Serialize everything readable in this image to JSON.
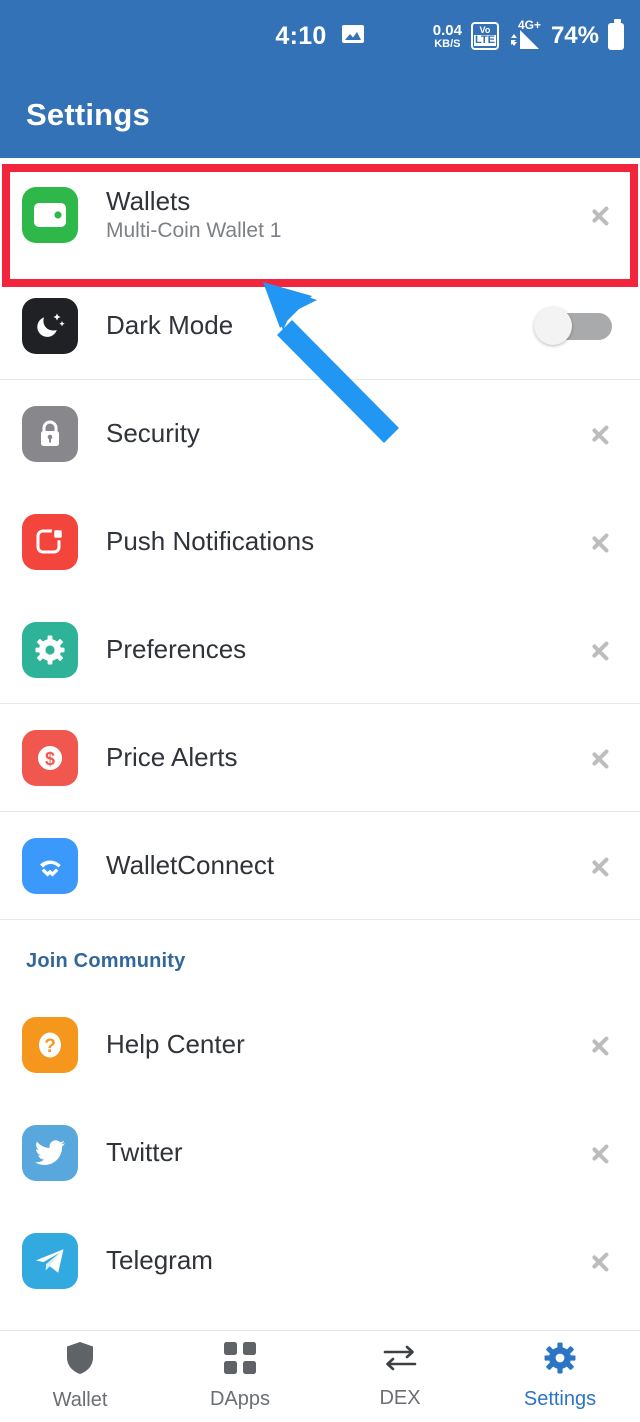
{
  "status_bar": {
    "time": "4:10",
    "screenshot_icon": "image-icon",
    "data_rate_value": "0.04",
    "data_rate_unit": "KB/S",
    "volte_top": "Vo",
    "volte_bottom": "LTE",
    "network_type": "4G+",
    "battery_percent": "74%"
  },
  "app_bar": {
    "title": "Settings"
  },
  "settings_items": [
    {
      "label": "Wallets",
      "sublabel": "Multi-Coin Wallet 1",
      "icon": "wallet-icon",
      "icon_color": "#2FB84A",
      "accessory": "chevron"
    },
    {
      "label": "Dark Mode",
      "sublabel": "",
      "icon": "moon-stars-icon",
      "icon_color": "#1F2124",
      "accessory": "toggle",
      "toggle_on": false
    },
    {
      "label": "Security",
      "sublabel": "",
      "icon": "lock-icon",
      "icon_color": "#87878C",
      "accessory": "chevron"
    },
    {
      "label": "Push Notifications",
      "sublabel": "",
      "icon": "notification-badge-icon",
      "icon_color": "#F4453C",
      "accessory": "chevron"
    },
    {
      "label": "Preferences",
      "sublabel": "",
      "icon": "gear-icon",
      "icon_color": "#2EB398",
      "accessory": "chevron"
    },
    {
      "label": "Price Alerts",
      "sublabel": "",
      "icon": "dollar-circle-icon",
      "icon_color": "#F0584F",
      "accessory": "chevron"
    },
    {
      "label": "WalletConnect",
      "sublabel": "",
      "icon": "walletconnect-icon",
      "icon_color": "#3B99FC",
      "accessory": "chevron"
    }
  ],
  "community_section": {
    "header": "Join Community",
    "header_color": "#336699",
    "items": [
      {
        "label": "Help Center",
        "icon": "question-mark-icon",
        "icon_color": "#F6971D",
        "accessory": "chevron"
      },
      {
        "label": "Twitter",
        "icon": "twitter-bird-icon",
        "icon_color": "#58A8DD",
        "accessory": "chevron"
      },
      {
        "label": "Telegram",
        "icon": "telegram-plane-icon",
        "icon_color": "#32AADF",
        "accessory": "chevron"
      }
    ]
  },
  "bottom_nav": {
    "active_index": 3,
    "active_color": "#2C74C4",
    "inactive_color": "#6B6E72",
    "items": [
      {
        "label": "Wallet",
        "icon": "shield-icon"
      },
      {
        "label": "DApps",
        "icon": "grid-squares-icon"
      },
      {
        "label": "DEX",
        "icon": "swap-arrows-icon"
      },
      {
        "label": "Settings",
        "icon": "gear-icon"
      }
    ]
  },
  "annotations": {
    "highlight_color": "#F3253E",
    "arrow_color": "#2196F3",
    "highlight_target": "Wallets",
    "arrow_target": "Wallets"
  }
}
